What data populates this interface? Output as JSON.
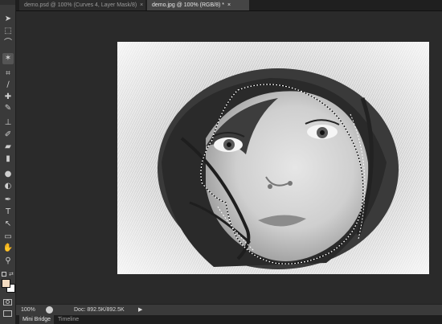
{
  "tabs": [
    {
      "label": "demo.psd @ 100% (Curves 4, Layer Mask/8)",
      "active": false
    },
    {
      "label": "demo.jpg @ 100% (RGB/8) *",
      "active": true
    }
  ],
  "tab_close_glyph": "×",
  "tools": [
    {
      "name": "move-tool-icon",
      "glyph": "➤"
    },
    {
      "name": "marquee-tool-icon",
      "glyph": "⬚"
    },
    {
      "name": "lasso-tool-icon",
      "glyph": "⌒"
    },
    {
      "name": "magic-wand-tool-icon",
      "glyph": "✶"
    },
    {
      "name": "crop-tool-icon",
      "glyph": "⌗"
    },
    {
      "name": "eyedropper-tool-icon",
      "glyph": "∕"
    },
    {
      "name": "healing-brush-tool-icon",
      "glyph": "✚"
    },
    {
      "name": "brush-tool-icon",
      "glyph": "✎"
    },
    {
      "name": "clone-stamp-tool-icon",
      "glyph": "⊥"
    },
    {
      "name": "history-brush-tool-icon",
      "glyph": "✐"
    },
    {
      "name": "eraser-tool-icon",
      "glyph": "▰"
    },
    {
      "name": "gradient-tool-icon",
      "glyph": "▮"
    },
    {
      "name": "blur-tool-icon",
      "glyph": "●"
    },
    {
      "name": "dodge-tool-icon",
      "glyph": "◐"
    },
    {
      "name": "pen-tool-icon",
      "glyph": "✒"
    },
    {
      "name": "type-tool-icon",
      "glyph": "T"
    },
    {
      "name": "path-selection-tool-icon",
      "glyph": "↖"
    },
    {
      "name": "shape-tool-icon",
      "glyph": "▭"
    },
    {
      "name": "hand-tool-icon",
      "glyph": "✋"
    },
    {
      "name": "zoom-tool-icon",
      "glyph": "⚲"
    }
  ],
  "colors": {
    "foreground": "#f3dcc2",
    "background": "#ffffff",
    "selection": "#ffffff"
  },
  "status": {
    "zoom": "100%",
    "doc": "Doc: 892.5K/892.5K"
  },
  "bottom_tabs": [
    {
      "label": "Mini Bridge",
      "active": true
    },
    {
      "label": "Timeline",
      "active": false
    }
  ]
}
